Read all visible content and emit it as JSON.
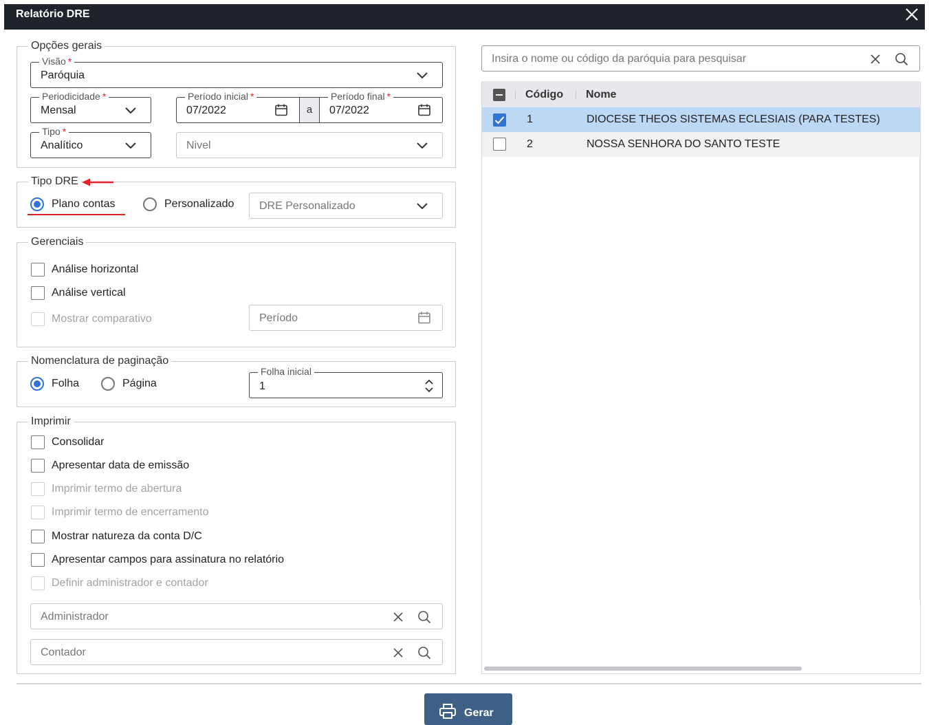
{
  "window": {
    "title": "Relatório DRE"
  },
  "opcoes_gerais": {
    "legend": "Opções gerais",
    "visao": {
      "label": "Visão",
      "required": "*",
      "value": "Paróquia"
    },
    "periodicidade": {
      "label": "Periodicidade",
      "required": "*",
      "value": "Mensal"
    },
    "periodo_inicial": {
      "label": "Período inicial",
      "required": "*",
      "value": "07/2022"
    },
    "periodo_sep": "a",
    "periodo_final": {
      "label": "Período final",
      "required": "*",
      "value": "07/2022"
    },
    "tipo": {
      "label": "Tipo",
      "required": "*",
      "value": "Analítico"
    },
    "nivel": {
      "placeholder": "Nivel"
    }
  },
  "tipo_dre": {
    "legend": "Tipo DRE",
    "plano_contas": "Plano contas",
    "personalizado": "Personalizado",
    "dre_personalizado": "DRE Personalizado",
    "selected": "Plano contas",
    "annotation_color": "#e0202a"
  },
  "gerenciais": {
    "legend": "Gerenciais",
    "analise_horizontal": "Análise horizontal",
    "analise_vertical": "Análise vertical",
    "mostrar_comparativo": "Mostrar comparativo",
    "periodo_placeholder": "Período"
  },
  "paginacao": {
    "legend": "Nomenclatura de paginação",
    "folha": "Folha",
    "pagina": "Página",
    "selected": "Folha",
    "folha_inicial": {
      "label": "Folha inicial",
      "value": "1"
    }
  },
  "imprimir": {
    "legend": "Imprimir",
    "options": [
      {
        "label": "Consolidar",
        "disabled": false
      },
      {
        "label": "Apresentar data de emissão",
        "disabled": false
      },
      {
        "label": "Imprimir termo de abertura",
        "disabled": true
      },
      {
        "label": "Imprimir termo de encerramento",
        "disabled": true
      },
      {
        "label": "Mostrar natureza da conta D/C",
        "disabled": false
      },
      {
        "label": "Apresentar campos para assinatura no relatório",
        "disabled": false
      },
      {
        "label": "Definir administrador e contador",
        "disabled": true
      }
    ],
    "administrador_placeholder": "Administrador",
    "contador_placeholder": "Contador"
  },
  "search": {
    "placeholder": "Insira o nome ou código da paróquia para pesquisar"
  },
  "grid": {
    "columns": [
      "Código",
      "Nome"
    ],
    "rows": [
      {
        "codigo": "1",
        "nome": "DIOCESE THEOS SISTEMAS ECLESIAIS (PARA TESTES)",
        "checked": true
      },
      {
        "codigo": "2",
        "nome": "NOSSA SENHORA DO SANTO TESTE",
        "checked": false
      }
    ]
  },
  "actions": {
    "gerar": "Gerar"
  },
  "colors": {
    "accent": "#2f74d0",
    "selected_row": "#bcd8f5",
    "button": "#3e5f86",
    "titlebar": "#1f232a"
  }
}
